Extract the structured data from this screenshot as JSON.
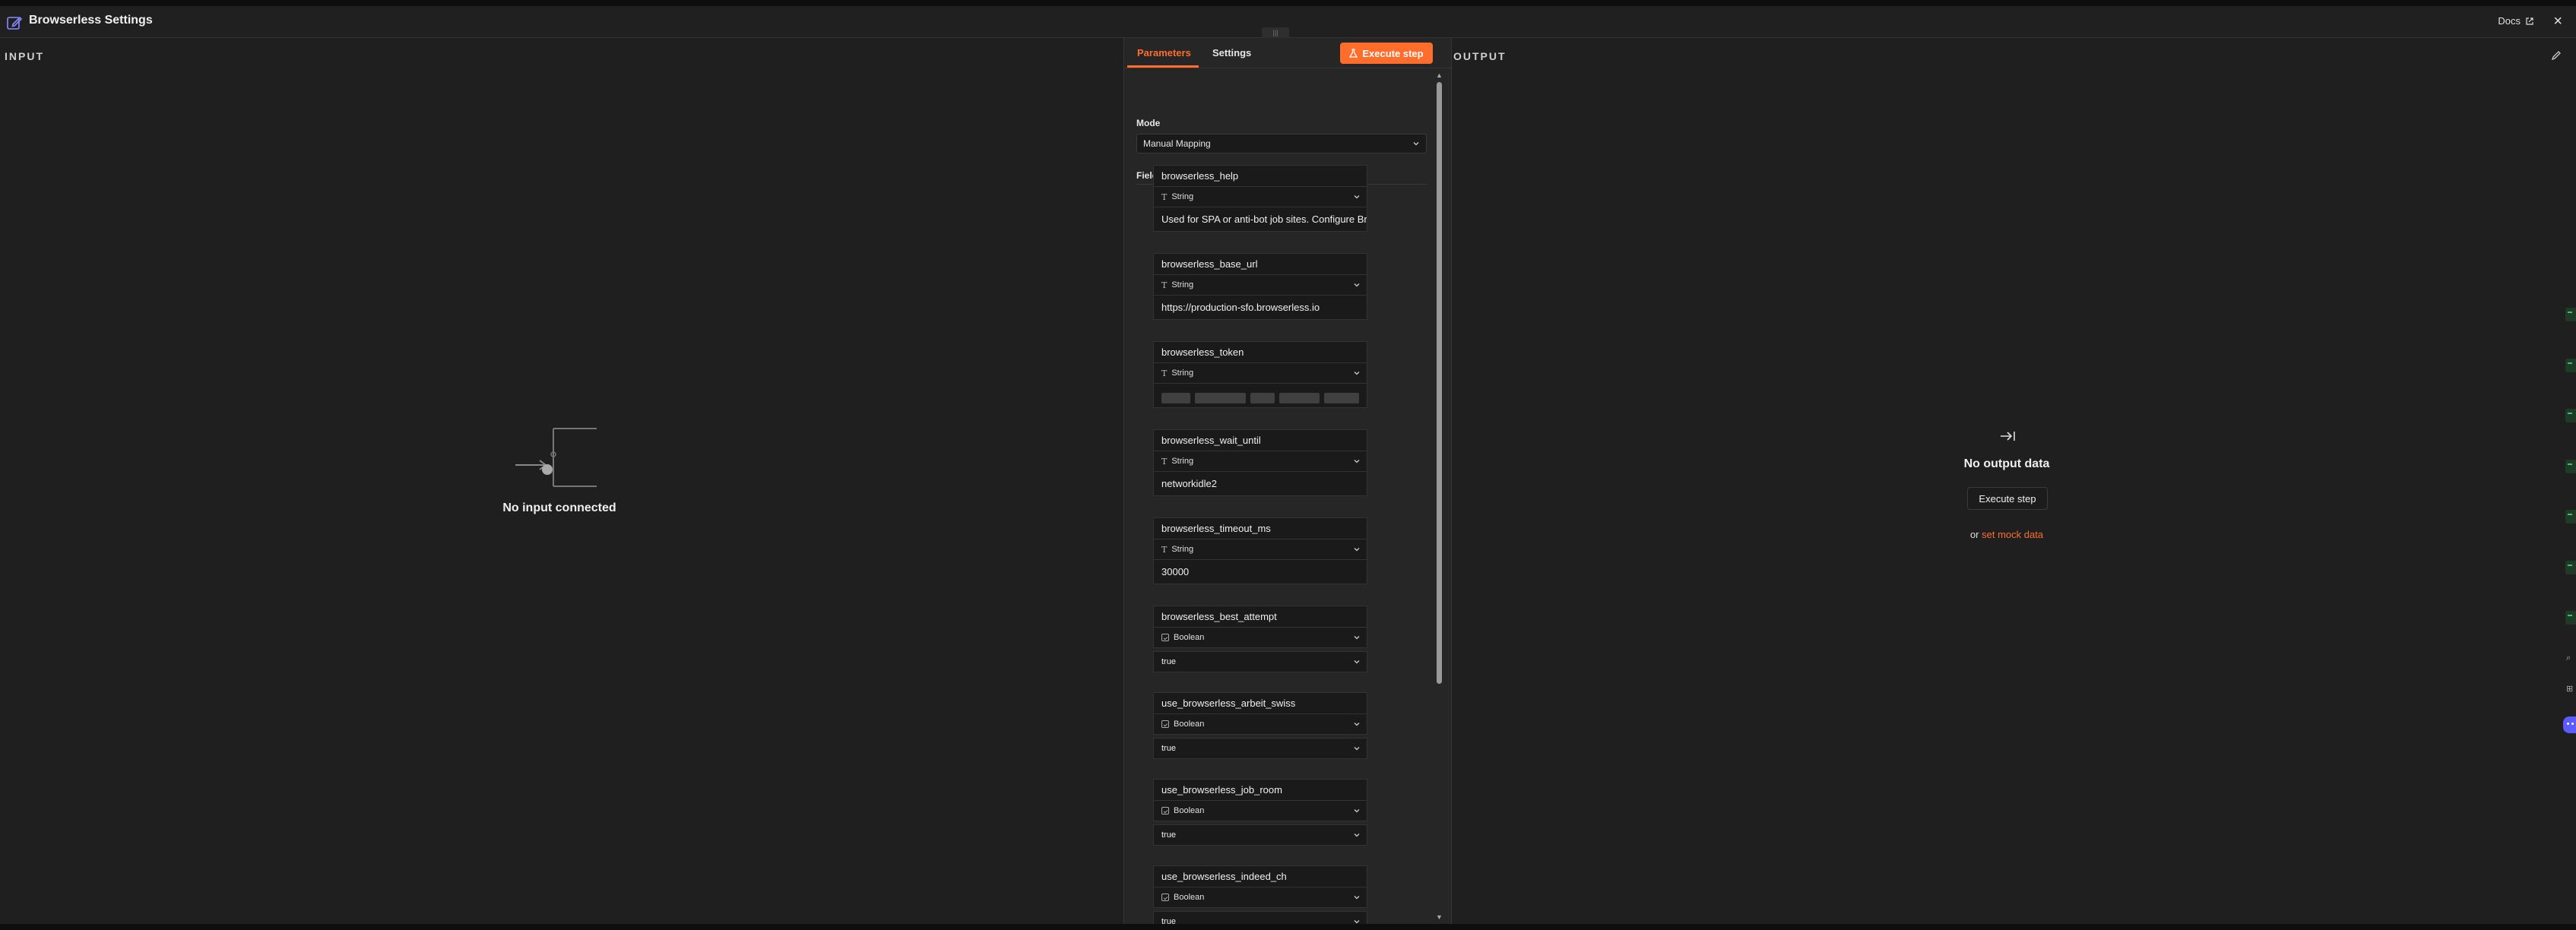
{
  "header": {
    "title": "Browserless Settings",
    "docs_label": "Docs",
    "close_label": "×"
  },
  "input_panel": {
    "label": "INPUT",
    "empty_message": "No input connected"
  },
  "output_panel": {
    "label": "OUTPUT",
    "empty_message": "No output data",
    "execute_label": "Execute step",
    "mock_prefix": "or",
    "mock_link": "set mock data"
  },
  "center": {
    "tabs": [
      {
        "label": "Parameters",
        "active": true
      },
      {
        "label": "Settings",
        "active": false
      }
    ],
    "execute_button": "Execute step",
    "mode_label": "Mode",
    "mode_value": "Manual Mapping",
    "fields_label": "Fields to Set",
    "fields": [
      {
        "name": "browserless_help",
        "type": "String",
        "value": "Used for SPA or anti-bot job sites. Configure Bro"
      },
      {
        "name": "browserless_base_url",
        "type": "String",
        "value": "https://production-sfo.browserless.io"
      },
      {
        "name": "browserless_token",
        "type": "String",
        "value": ""
      },
      {
        "name": "browserless_wait_until",
        "type": "String",
        "value": "networkidle2"
      },
      {
        "name": "browserless_timeout_ms",
        "type": "String",
        "value": "30000"
      },
      {
        "name": "browserless_best_attempt",
        "type": "Boolean",
        "value": "true"
      },
      {
        "name": "use_browserless_arbeit_swiss",
        "type": "Boolean",
        "value": "true"
      },
      {
        "name": "use_browserless_job_room",
        "type": "Boolean",
        "value": "true"
      },
      {
        "name": "use_browserless_indeed_ch",
        "type": "Boolean",
        "value": "true"
      }
    ]
  },
  "colors": {
    "accent": "#ff6d2d",
    "background": "#1f1f1f",
    "panel": "#262626"
  }
}
